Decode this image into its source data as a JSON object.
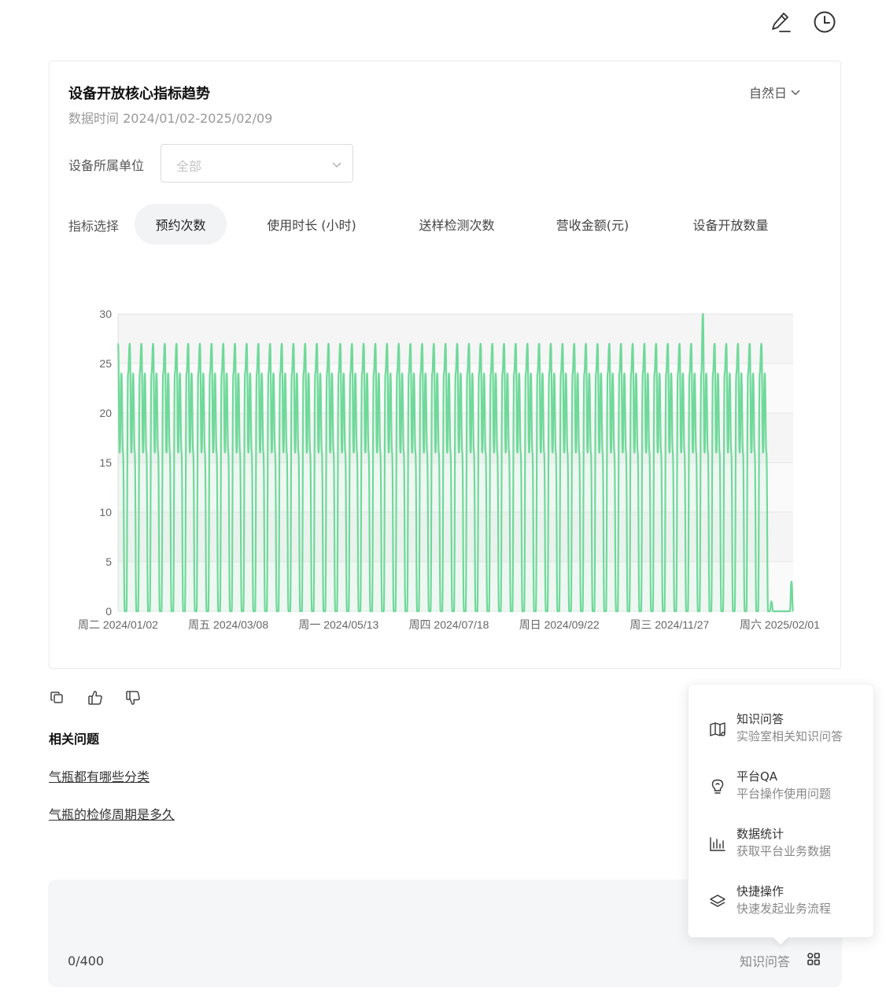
{
  "topbar": {
    "edit_icon": "edit-icon",
    "history_icon": "history-icon"
  },
  "card": {
    "title": "设备开放核心指标趋势",
    "time_label": "数据时间",
    "time_range": "2024/01/02-2025/02/09",
    "period": "自然日",
    "filter_label": "设备所属单位",
    "filter_placeholder": "全部",
    "metric_label": "指标选择",
    "metrics": [
      "预约次数",
      "使用时长 (小时)",
      "送样检测次数",
      "营收金额(元)",
      "设备开放数量"
    ],
    "active_metric": 0
  },
  "chart_data": {
    "type": "line",
    "series": [
      {
        "values": []
      }
    ],
    "yticks": [
      "0",
      "5",
      "10",
      "15",
      "20",
      "25",
      "30"
    ],
    "xticks": [
      "周二 2024/01/02",
      "周五 2024/03/08",
      "周一 2024/05/13",
      "周四 2024/07/18",
      "周日 2024/09/22",
      "周三 2024/11/27",
      "周六 2025/02/01"
    ],
    "ylim": [
      0,
      30
    ],
    "x_start": "2024/01/02",
    "x_end": "2025/02/09",
    "grid": true,
    "color": "#6fd99a",
    "weekly_pattern": "周一 ≈24, 周二 ≈27, 周三 ≈16, 周四 ≈24, 周五 ≈16, 周六 0, 周日 0",
    "peak": {
      "x": "2024/12/17",
      "y": 30
    },
    "tail_values": [
      {
        "x": "2025/01/27",
        "y": 1
      },
      {
        "x": "2025/02/08",
        "y": 3
      }
    ]
  },
  "actions": {
    "copy": "copy-icon",
    "like": "thumbs-up-icon",
    "dislike": "thumbs-down-icon"
  },
  "related": {
    "title": "相关问题",
    "questions": [
      "气瓶都有哪些分类",
      "气瓶的检修周期是多久"
    ]
  },
  "input": {
    "counter": "0/400",
    "mode": "知识问答"
  },
  "popover": {
    "items": [
      {
        "title": "知识问答",
        "desc": "实验室相关知识问答",
        "icon": "book-icon"
      },
      {
        "title": "平台QA",
        "desc": "平台操作使用问题",
        "icon": "lightbulb-icon"
      },
      {
        "title": "数据统计",
        "desc": "获取平台业务数据",
        "icon": "bar-chart-icon"
      },
      {
        "title": "快捷操作",
        "desc": "快速发起业务流程",
        "icon": "layers-icon"
      }
    ]
  }
}
